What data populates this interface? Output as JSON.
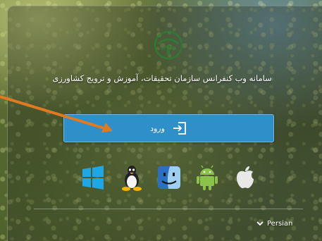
{
  "header": {
    "title": "سامانه وب کنفرانس سازمان تحقیقات، آموزش و ترویج کشاورزی"
  },
  "login": {
    "label": "ورود"
  },
  "os_icons": [
    "windows-icon",
    "linux-icon",
    "mac-finder-icon",
    "android-icon",
    "apple-icon"
  ],
  "language": {
    "selected": "Persian"
  },
  "colors": {
    "button": "#2f8fc8",
    "annotation_arrow": "#e07a22"
  }
}
